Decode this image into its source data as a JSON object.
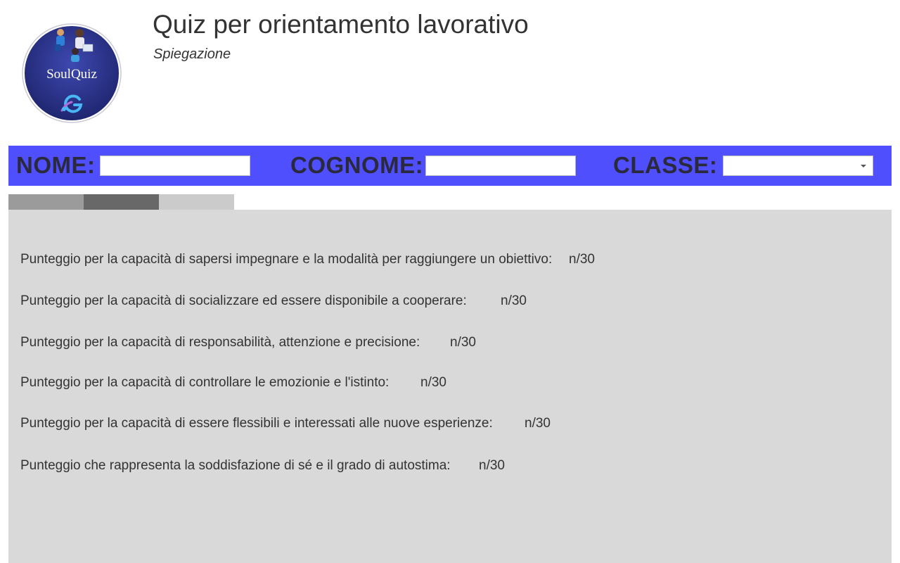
{
  "header": {
    "title": "Quiz per orientamento lavorativo",
    "subtitle": "Spiegazione",
    "logo_text": "SoulQuiz"
  },
  "student": {
    "name_label": "NOME:",
    "name_value": "",
    "surname_label": "COGNOME:",
    "surname_value": "",
    "class_label": "CLASSE:",
    "class_value": ""
  },
  "tabs": [
    {
      "color": "#9b9b9b"
    },
    {
      "color": "#686868"
    },
    {
      "color": "#cbcbcb"
    }
  ],
  "scores": [
    {
      "label": "Punteggio per la capacità di sapersi impegnare e la modalità per raggiungere un obiettivo:",
      "value": "n/30"
    },
    {
      "label": "Punteggio per la capacità di socializzare ed essere disponibile a cooperare:",
      "value": "n/30"
    },
    {
      "label": "Punteggio per la capacità di responsabilità, attenzione e precisione:",
      "value": "n/30"
    },
    {
      "label": "Punteggio per la capacità di controllare le emozionie e l'istinto:",
      "value": "n/30"
    },
    {
      "label": "Punteggio per la capacità di essere flessibili e interessati alle nuove esperienze:",
      "value": "n/30"
    },
    {
      "label": "Punteggio che rappresenta la soddisfazione di sé e il grado di autostima:",
      "value": "n/30"
    }
  ],
  "colors": {
    "bar": "#4f4ffd",
    "panel": "#d9d9d9",
    "text": "#333333"
  }
}
